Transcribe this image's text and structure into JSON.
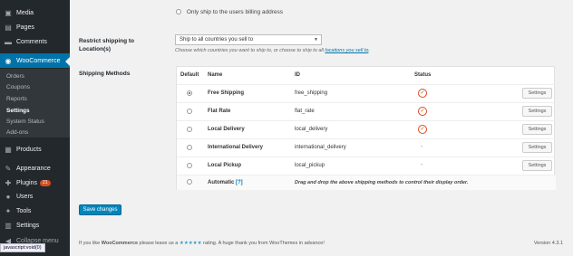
{
  "sidebar": {
    "items": [
      {
        "label": "Media",
        "icon": "media-icon"
      },
      {
        "label": "Pages",
        "icon": "pages-icon"
      },
      {
        "label": "Comments",
        "icon": "comments-icon"
      },
      {
        "label": "WooCommerce",
        "icon": "woocommerce-icon"
      },
      {
        "label": "Products",
        "icon": "products-icon"
      },
      {
        "label": "Appearance",
        "icon": "appearance-icon"
      },
      {
        "label": "Plugins",
        "icon": "plugins-icon",
        "badge": "21"
      },
      {
        "label": "Users",
        "icon": "users-icon"
      },
      {
        "label": "Tools",
        "icon": "tools-icon"
      },
      {
        "label": "Settings",
        "icon": "settings-icon"
      },
      {
        "label": "Collapse menu",
        "icon": "collapse-icon"
      }
    ],
    "submenu": [
      "Orders",
      "Coupons",
      "Reports",
      "Settings",
      "System Status",
      "Add-ons"
    ]
  },
  "status_bar_url": "javascript:void(0)",
  "billing_option": "Only ship to the users billing address",
  "restrict": {
    "label": "Restrict shipping to Location(s)",
    "selected": "Ship to all countries you sell to",
    "desc_prefix": "Choose which countries you want to ship to, or choose to ship to all ",
    "desc_link": "locations you sell to",
    "desc_suffix": "."
  },
  "methods": {
    "label": "Shipping Methods",
    "headers": {
      "default": "Default",
      "name": "Name",
      "id": "ID",
      "status": "Status"
    },
    "rows": [
      {
        "name": "Free Shipping",
        "id": "free_shipping",
        "enabled": true,
        "default": true,
        "button": "Settings"
      },
      {
        "name": "Flat Rate",
        "id": "flat_rate",
        "enabled": true,
        "default": false,
        "button": "Settings"
      },
      {
        "name": "Local Delivery",
        "id": "local_delivery",
        "enabled": true,
        "default": false,
        "button": "Settings"
      },
      {
        "name": "International Delivery",
        "id": "international_delivery",
        "enabled": false,
        "default": false,
        "button": "Settings"
      },
      {
        "name": "Local Pickup",
        "id": "local_pickup",
        "enabled": false,
        "default": false,
        "button": "Settings"
      }
    ],
    "status_dash": "-",
    "automatic": "Automatic",
    "automatic_help": "[?]",
    "drag_note": "Drag and drop the above shipping methods to control their display order."
  },
  "save_label": "Save changes",
  "footer": {
    "prefix": "If you like ",
    "brand": "WooCommerce",
    "middle": " please leave us a ",
    "stars": "★★★★★",
    "suffix": " rating. A huge thank you from WooThemes in advance!",
    "version": "Version 4.3.1"
  },
  "colors": {
    "accent": "#0073aa",
    "sidebar": "#23282d",
    "button": "#0085ba",
    "status": "#d54e21"
  }
}
